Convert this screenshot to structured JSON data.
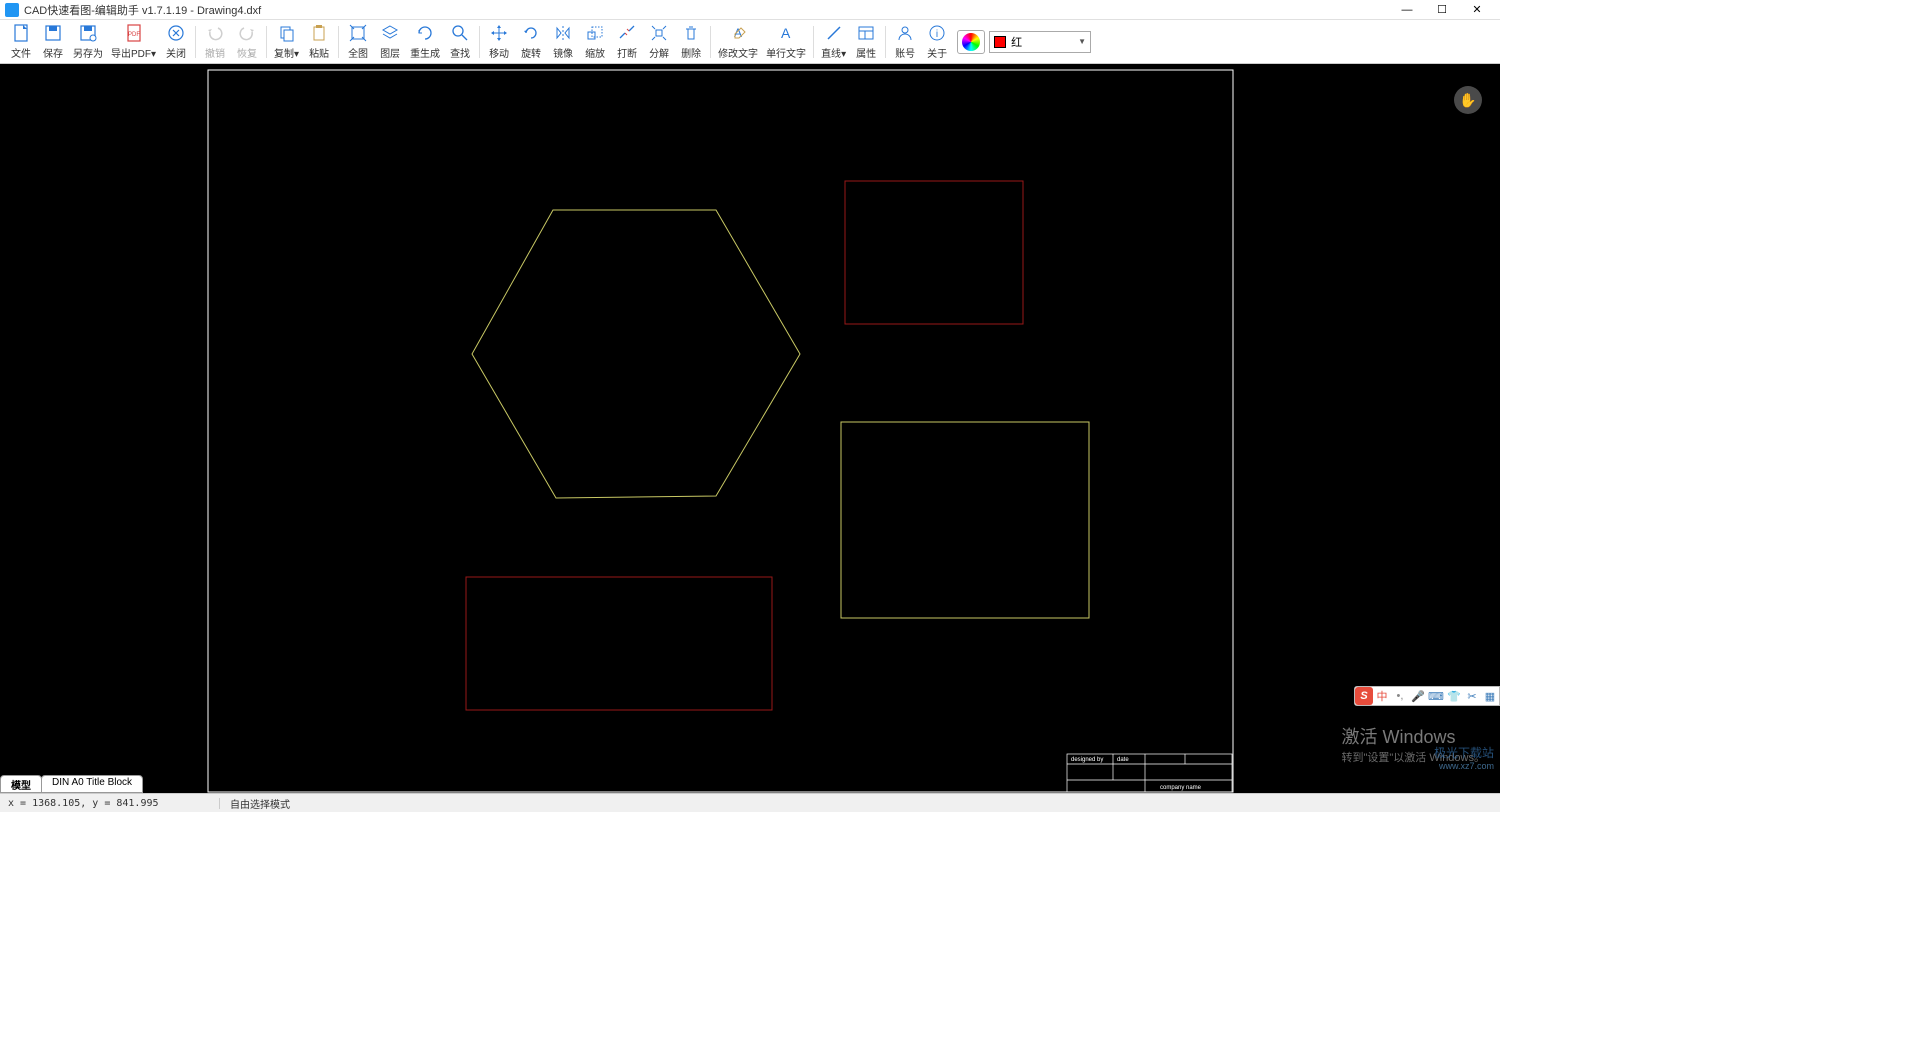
{
  "app": {
    "title": "CAD快速看图-编辑助手 v1.7.1.19 - Drawing4.dxf"
  },
  "toolbar": {
    "file": "文件",
    "save": "保存",
    "save_as": "另存为",
    "export_pdf": "导出PDF",
    "close": "关闭",
    "undo": "撤销",
    "redo": "恢复",
    "copy": "复制",
    "paste": "粘贴",
    "zoom_all": "全图",
    "layers": "图层",
    "regen": "重生成",
    "find": "查找",
    "move": "移动",
    "rotate": "旋转",
    "mirror": "镜像",
    "scale": "缩放",
    "break": "打断",
    "explode": "分解",
    "delete": "删除",
    "edit_text": "修改文字",
    "single_text": "单行文字",
    "line": "直线",
    "properties": "属性",
    "account": "账号",
    "about": "关于"
  },
  "color": {
    "current_name": "红",
    "current_hex": "#ff0000"
  },
  "tabs": {
    "model": "模型",
    "layout1": "DIN A0 Title Block"
  },
  "status": {
    "coords": "x = 1368.105, y = 841.995",
    "mode": "自由选择模式"
  },
  "watermark": {
    "title": "激活 Windows",
    "subtitle": "转到\"设置\"以激活 Windows。"
  },
  "brand": {
    "name": "极光下载站",
    "url": "www.xz7.com"
  },
  "titleblock": {
    "designed_by": "designed by",
    "date": "date",
    "company": "company name"
  },
  "colors": {
    "frame": "#ffffff",
    "hexagon": "#c8c864",
    "rect_red": "#991818",
    "rect_yellow": "#c8c864"
  }
}
